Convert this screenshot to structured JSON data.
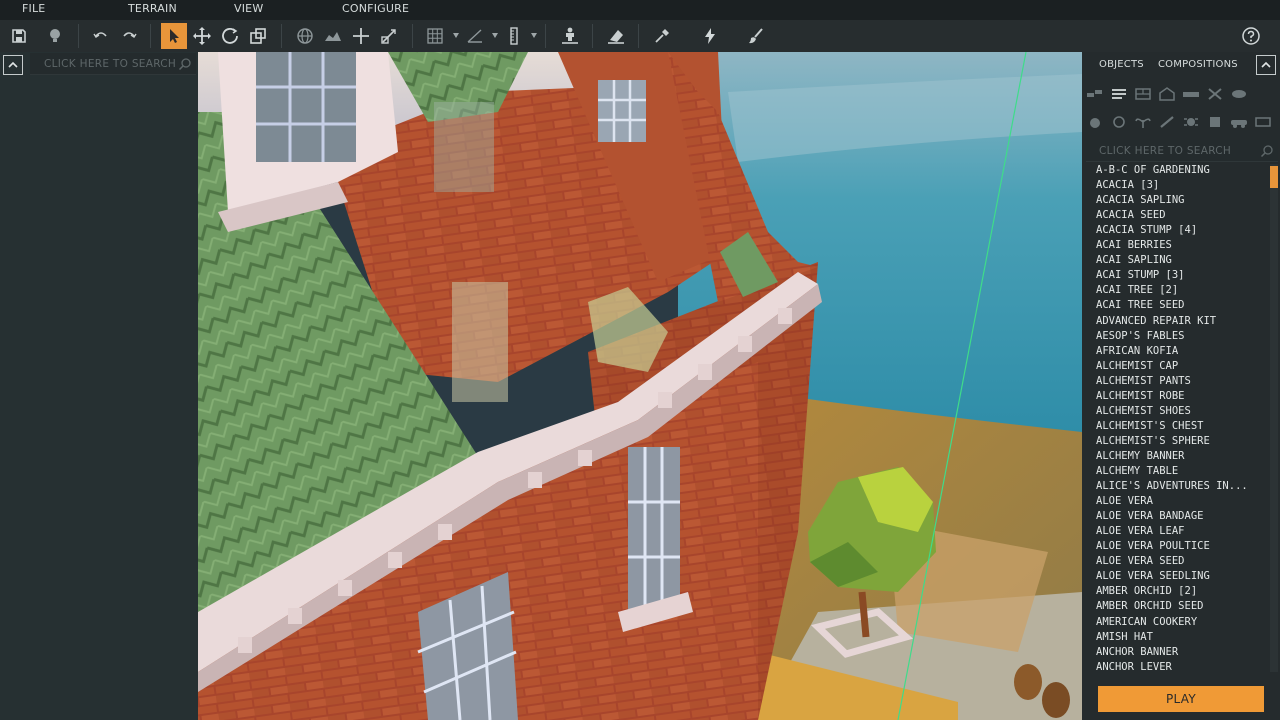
{
  "menu": {
    "file": "FILE",
    "terrain": "TERRAIN",
    "view": "VIEW",
    "configure": "CONFIGURE"
  },
  "toolbar": {
    "active_tool": "select",
    "accent": "#e8953a",
    "icons": [
      "save-icon",
      "lightbulb-icon",
      "undo-icon",
      "redo-icon",
      "select-arrow-icon",
      "move-icon",
      "rotate-icon",
      "scale-icon",
      "globe-icon",
      "terrain-icon",
      "snap-icon",
      "resize-icon",
      "grid-icon",
      "angle-icon",
      "ruler-icon",
      "character-icon",
      "eraser-icon",
      "eyedropper-icon",
      "lightning-icon",
      "paintbrush-icon",
      "help-icon"
    ]
  },
  "left_panel": {
    "search_placeholder": "CLICK HERE TO SEARCH"
  },
  "right_panel": {
    "tabs": [
      "OBJECTS",
      "COMPOSITIONS"
    ],
    "active_tab": "OBJECTS",
    "search_placeholder": "CLICK HERE TO SEARCH",
    "objects": [
      "A-B-C OF GARDENING",
      "ACACIA [3]",
      "ACACIA SAPLING",
      "ACACIA SEED",
      "ACACIA STUMP [4]",
      "ACAI BERRIES",
      "ACAI SAPLING",
      "ACAI STUMP [3]",
      "ACAI TREE [2]",
      "ACAI TREE SEED",
      "ADVANCED REPAIR KIT",
      "AESOP'S FABLES",
      "AFRICAN KOFIA",
      "ALCHEMIST CAP",
      "ALCHEMIST PANTS",
      "ALCHEMIST ROBE",
      "ALCHEMIST SHOES",
      "ALCHEMIST'S CHEST",
      "ALCHEMIST'S SPHERE",
      "ALCHEMY BANNER",
      "ALCHEMY TABLE",
      "ALICE'S ADVENTURES IN...",
      "ALOE VERA",
      "ALOE VERA BANDAGE",
      "ALOE VERA LEAF",
      "ALOE VERA POULTICE",
      "ALOE VERA SEED",
      "ALOE VERA SEEDLING",
      "AMBER ORCHID [2]",
      "AMBER ORCHID SEED",
      "AMERICAN COOKERY",
      "AMISH HAT",
      "ANCHOR BANNER",
      "ANCHOR LEVER"
    ],
    "play_label": "PLAY"
  }
}
